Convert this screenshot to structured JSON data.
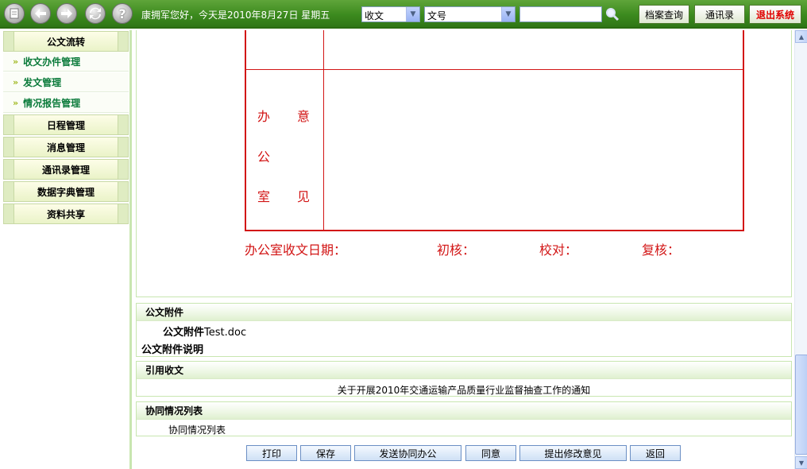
{
  "toolbar": {
    "icons": [
      "home-icon",
      "back-icon",
      "forward-icon",
      "refresh-icon",
      "help-icon"
    ],
    "greeting": "康拥军您好，今天是2010年8月27日 星期五",
    "doc_type_value": "收文",
    "field_value": "文号",
    "search_value": "",
    "archive_button": "档案查询",
    "contacts_button": "通讯录",
    "logout_button": "退出系统",
    "logout_color": "#e00000"
  },
  "sidebar": {
    "section_title": "公文流转",
    "sub_items": [
      "收文办件管理",
      "发文管理",
      "情况报告管理"
    ],
    "menus": [
      "日程管理",
      "消息管理",
      "通讯录管理",
      "数据字典管理",
      "资料共享"
    ]
  },
  "form": {
    "row_label_col1": "办",
    "row_label_col2": "意",
    "row_label_col3": "公",
    "row_label_col4": "室",
    "row_label_col5": "见",
    "receive_date_label": "办公室收文日期：",
    "first_check_label": "初核：",
    "proofread_label": "校对：",
    "recheck_label": "复核：",
    "form_line_color": "#d21515"
  },
  "attachment": {
    "title": "公文附件",
    "file_label": "公文附件",
    "file_name": "Test.doc",
    "desc_label": "公文附件说明"
  },
  "reference": {
    "title": "引用收文",
    "doc_title": "关于开展2010年交通运输产品质量行业监督抽查工作的通知"
  },
  "coop": {
    "title": "协同情况列表",
    "content": "协同情况列表"
  },
  "actions": {
    "print": "打印",
    "save": "保存",
    "send_coop": "发送协同办公",
    "agree": "同意",
    "suggest": "提出修改意见",
    "back": "返回"
  }
}
